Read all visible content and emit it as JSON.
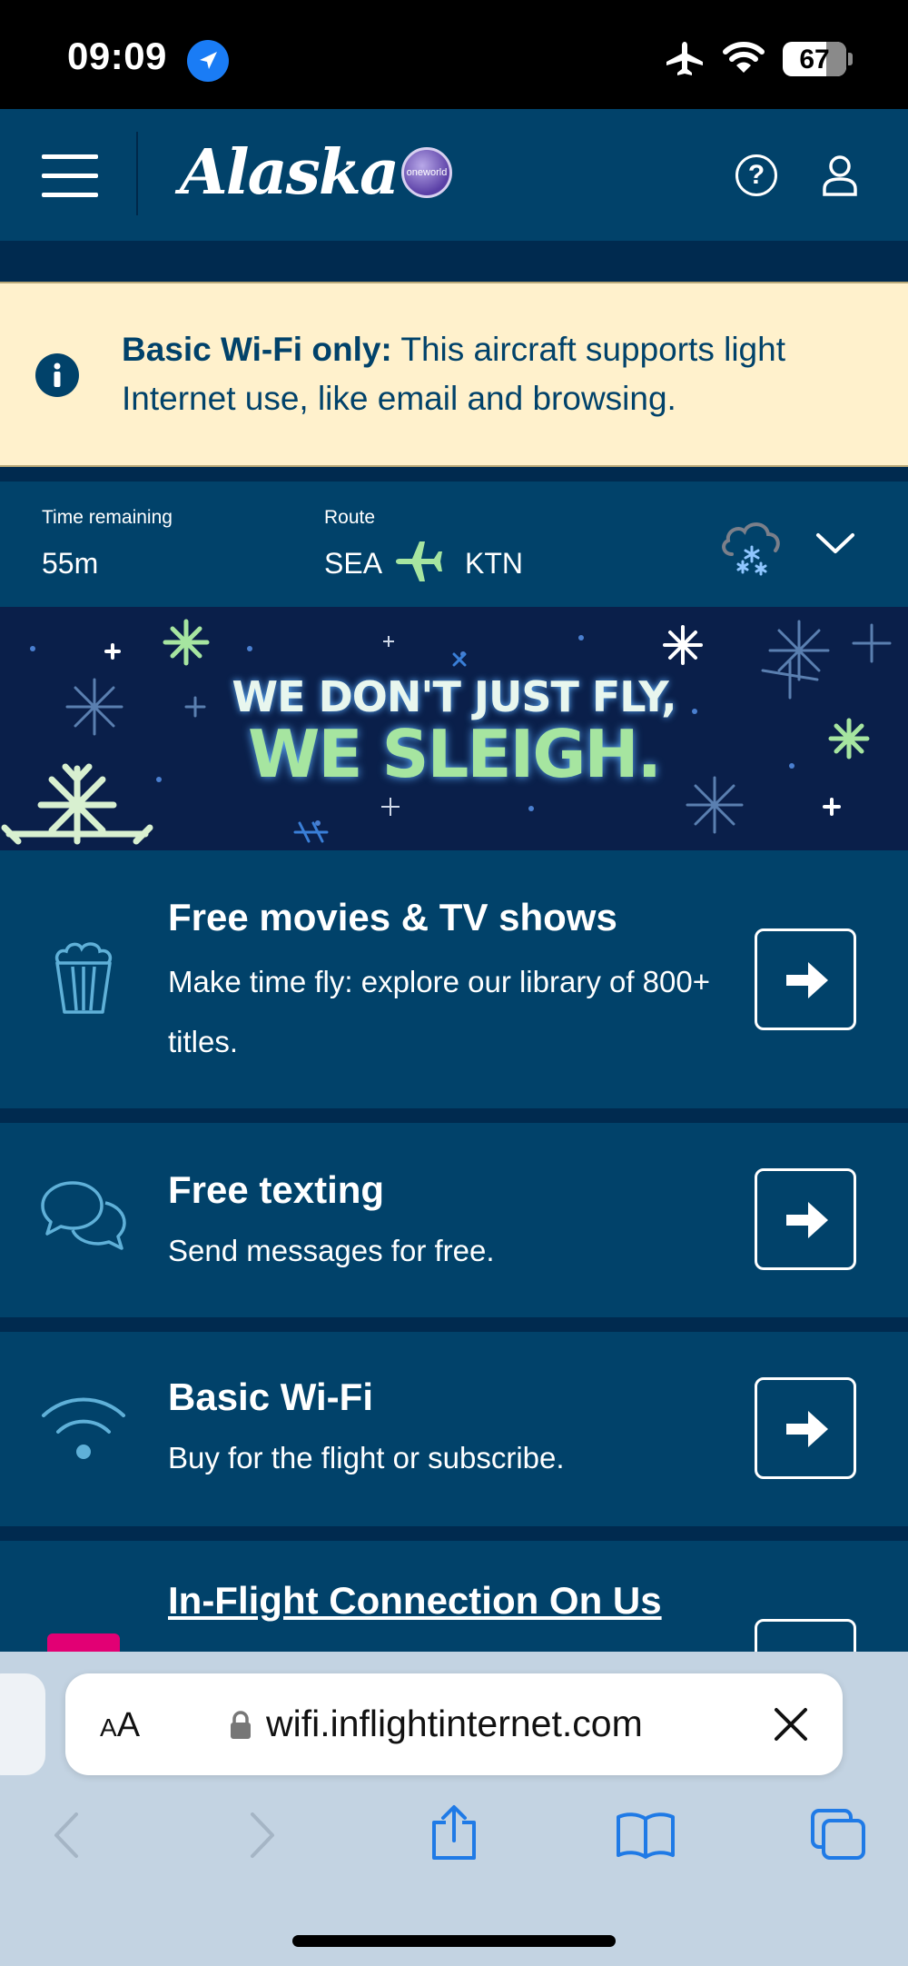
{
  "status_bar": {
    "time": "09:09",
    "battery": "67"
  },
  "header": {
    "logo_text": "Alaska",
    "oneworld": "oneworld"
  },
  "alert": {
    "bold": "Basic Wi-Fi only:",
    "text": " This aircraft supports light Internet use, like email and browsing."
  },
  "flight": {
    "time_label": "Time remaining",
    "time_value": "55m",
    "route_label": "Route",
    "origin": "SEA",
    "destination": "KTN"
  },
  "banner": {
    "line1": "WE DON'T JUST FLY,",
    "line2": "WE SLEIGH."
  },
  "cards": [
    {
      "title": "Free movies & TV shows",
      "desc": "Make time fly: explore our library of 800+ titles.",
      "icon": "popcorn-icon"
    },
    {
      "title": "Free texting",
      "desc": "Send messages for free.",
      "icon": "chat-icon"
    },
    {
      "title": "Basic Wi-Fi",
      "desc": "Buy for the flight or subscribe.",
      "icon": "wifi-icon"
    },
    {
      "title": "In-Flight Connection On Us",
      "icon": "t-mobile-icon"
    }
  ],
  "safari": {
    "text_size": "AA",
    "url": "wifi.inflightinternet.com"
  },
  "colors": {
    "navy": "#01426a",
    "dark_band": "#002a4f",
    "alert_bg": "#fff1cc",
    "accent_green": "#a6e5a0"
  }
}
